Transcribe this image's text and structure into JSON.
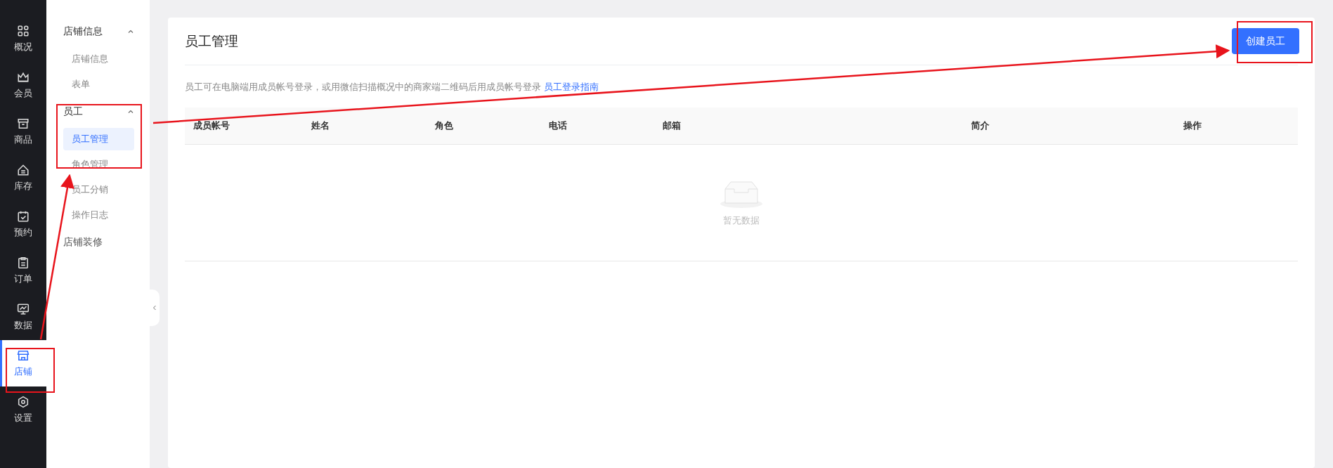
{
  "rail": [
    {
      "label": "概况",
      "selected": false
    },
    {
      "label": "会员",
      "selected": false
    },
    {
      "label": "商品",
      "selected": false
    },
    {
      "label": "库存",
      "selected": false
    },
    {
      "label": "预约",
      "selected": false
    },
    {
      "label": "订单",
      "selected": false
    },
    {
      "label": "数据",
      "selected": false
    },
    {
      "label": "店铺",
      "selected": true
    },
    {
      "label": "设置",
      "selected": false
    }
  ],
  "submenu": [
    {
      "label": "店铺信息",
      "expanded": true,
      "children": [
        {
          "label": "店铺信息",
          "selected": false
        },
        {
          "label": "表单",
          "selected": false
        }
      ]
    },
    {
      "label": "员工",
      "expanded": true,
      "children": [
        {
          "label": "员工管理",
          "selected": true
        },
        {
          "label": "角色管理",
          "selected": false
        },
        {
          "label": "员工分销",
          "selected": false
        },
        {
          "label": "操作日志",
          "selected": false
        }
      ]
    },
    {
      "label": "店铺装修"
    }
  ],
  "page": {
    "title": "员工管理",
    "create_button": "创建员工",
    "description": "员工可在电脑端用成员帐号登录，或用微信扫描概况中的商家端二维码后用成员帐号登录",
    "guide_link": "员工登录指南"
  },
  "table": {
    "columns": [
      "成员帐号",
      "姓名",
      "角色",
      "电话",
      "邮箱",
      "简介",
      "操作"
    ],
    "empty_text": "暂无数据"
  }
}
